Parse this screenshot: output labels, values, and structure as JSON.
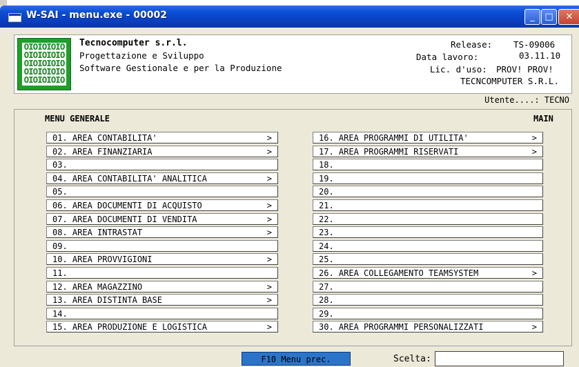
{
  "window": {
    "title": "W-SAI - menu.exe - 00002",
    "min_icon": "_",
    "max_icon": "□",
    "close_icon": "✕"
  },
  "header": {
    "company": "Tecnocomputer s.r.l.",
    "line1": "Progettazione e Sviluppo",
    "line2": "Software Gestionale e per la Produzione",
    "release_label": "Release:",
    "release_value": "TS-09006",
    "data_label": "Data lavoro:",
    "data_value": "03.11.10",
    "lic_label": "Lic. d'uso:",
    "lic_value": "PROV! PROV!",
    "licensee": "TECNCOMPUTER S.R.L.",
    "logo_text": "OIOIOIOIO\nOIOIOIOIO\nOIOIOIOIO\nOIOIOIOIO\nOIOIOIOIO"
  },
  "utente": "Utente....: TECNO",
  "menu": {
    "title_left": "MENU GENERALE",
    "title_right": "MAIN",
    "left": [
      {
        "label": "01. AREA CONTABILITA'",
        "arrow": ">"
      },
      {
        "label": "02. AREA FINANZIARIA",
        "arrow": ">"
      },
      {
        "label": "03.",
        "arrow": ""
      },
      {
        "label": "04. AREA CONTABILITA' ANALITICA",
        "arrow": ">"
      },
      {
        "label": "05.",
        "arrow": ""
      },
      {
        "label": "06. AREA DOCUMENTI DI ACQUISTO",
        "arrow": ">"
      },
      {
        "label": "07. AREA DOCUMENTI DI VENDITA",
        "arrow": ">"
      },
      {
        "label": "08. AREA INTRASTAT",
        "arrow": ">"
      },
      {
        "label": "09.",
        "arrow": ""
      },
      {
        "label": "10. AREA PROVVIGIONI",
        "arrow": ">"
      },
      {
        "label": "11.",
        "arrow": ""
      },
      {
        "label": "12. AREA MAGAZZINO",
        "arrow": ">"
      },
      {
        "label": "13. AREA DISTINTA BASE",
        "arrow": ">"
      },
      {
        "label": "14.",
        "arrow": ""
      },
      {
        "label": "15. AREA PRODUZIONE E LOGISTICA",
        "arrow": ">"
      }
    ],
    "right": [
      {
        "label": "16. AREA PROGRAMMI DI UTILITA'",
        "arrow": ">"
      },
      {
        "label": "17. AREA PROGRAMMI RISERVATI",
        "arrow": ">"
      },
      {
        "label": "18.",
        "arrow": ""
      },
      {
        "label": "19.",
        "arrow": ""
      },
      {
        "label": "20.",
        "arrow": ""
      },
      {
        "label": "21.",
        "arrow": ""
      },
      {
        "label": "22.",
        "arrow": ""
      },
      {
        "label": "23.",
        "arrow": ""
      },
      {
        "label": "24.",
        "arrow": ""
      },
      {
        "label": "25.",
        "arrow": ""
      },
      {
        "label": "26. AREA COLLEGAMENTO TEAMSYSTEM",
        "arrow": ">"
      },
      {
        "label": "27.",
        "arrow": ""
      },
      {
        "label": "28.",
        "arrow": ""
      },
      {
        "label": "29.",
        "arrow": ""
      },
      {
        "label": "30. AREA PROGRAMMI PERSONALIZZATI",
        "arrow": ">"
      }
    ]
  },
  "footer": {
    "f10_label": "F10  Menu prec.",
    "scelta_label": "Scelta:",
    "scelta_value": ""
  },
  "colors": {
    "titlebar": "#0a4fd4",
    "logo_green": "#1f9e2a",
    "f10_blue": "#2c74c8"
  }
}
